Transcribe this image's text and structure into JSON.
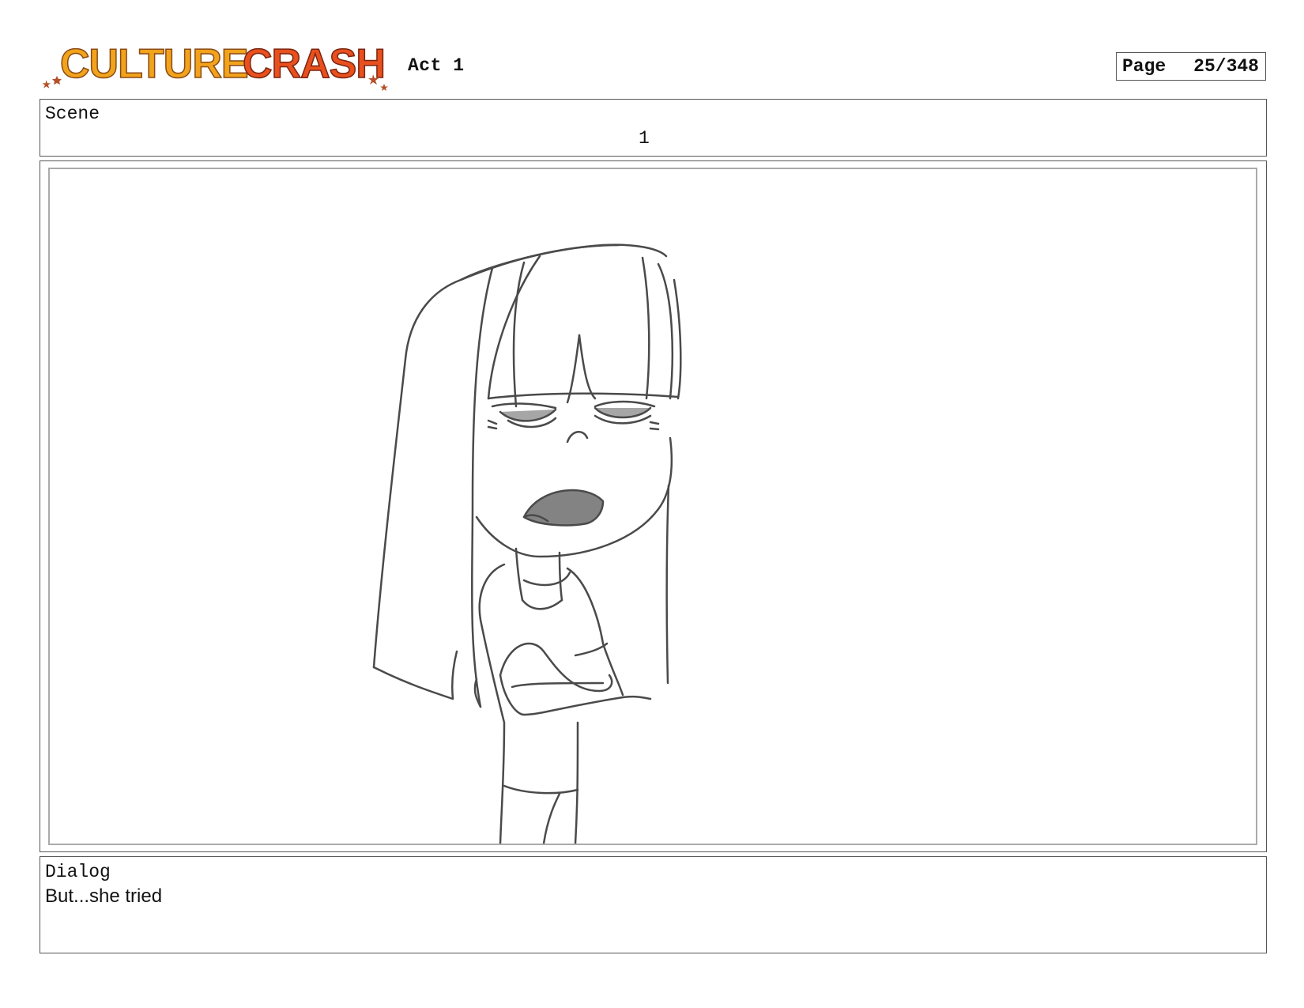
{
  "header": {
    "logo_text": "CULTURE CRASH",
    "act": "Act 1",
    "page_label": "Page",
    "page_value": "25/348"
  },
  "scene": {
    "label": "Scene",
    "value": "1"
  },
  "panel": {
    "image_name": "storyboard-sketch"
  },
  "dialog": {
    "label": "Dialog",
    "text": "But...she tried"
  },
  "colors": {
    "logo_yellow": "#f2a31c",
    "logo_orange": "#e8501e",
    "sketch_stroke": "#4a4a4a"
  }
}
